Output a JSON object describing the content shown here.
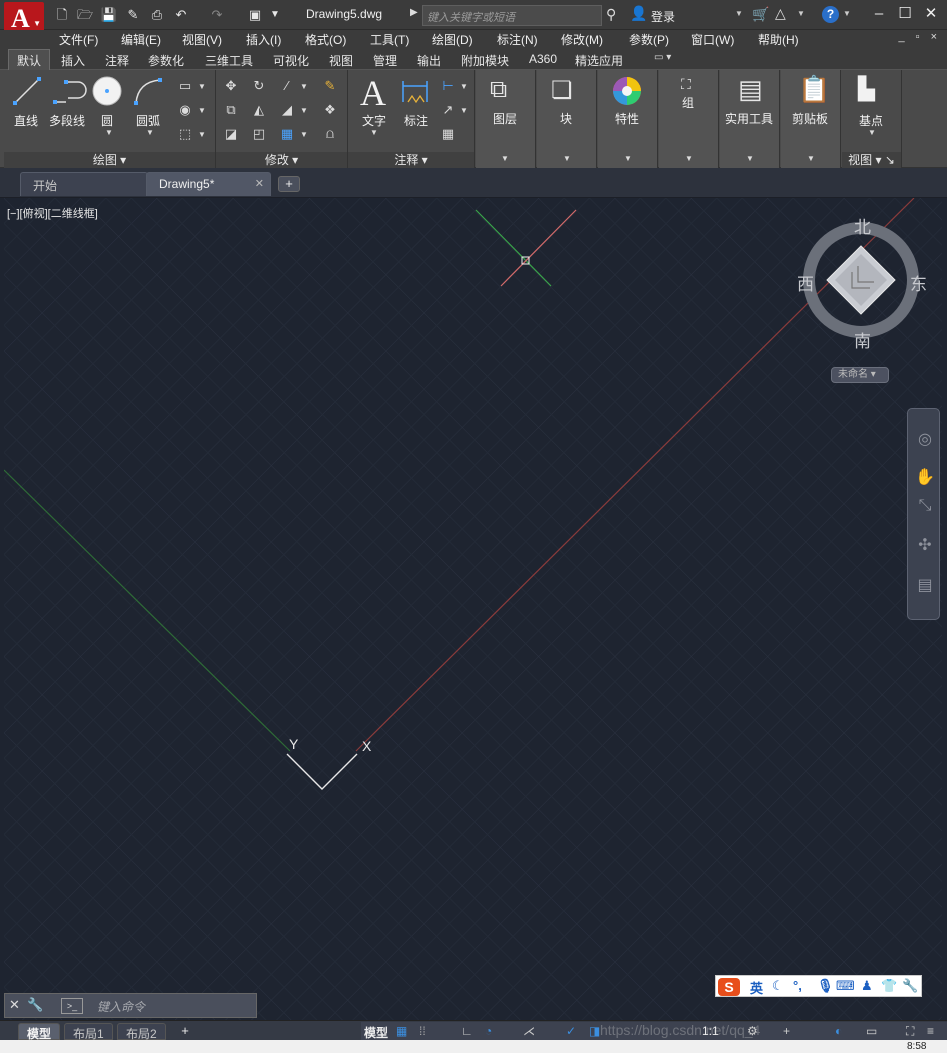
{
  "titlebar": {
    "app_letter": "A",
    "doc_title": "Drawing5.dwg",
    "search_placeholder": "键入关键字或短语",
    "login": "登录"
  },
  "menubar": {
    "items": [
      "文件(F)",
      "编辑(E)",
      "视图(V)",
      "插入(I)",
      "格式(O)",
      "工具(T)",
      "绘图(D)",
      "标注(N)",
      "修改(M)",
      "参数(P)",
      "窗口(W)",
      "帮助(H)"
    ],
    "window_controls": "_ ▫ ×"
  },
  "ribbon_tabs": [
    "默认",
    "插入",
    "注释",
    "参数化",
    "三维工具",
    "可视化",
    "视图",
    "管理",
    "输出",
    "附加模块",
    "A360",
    "精选应用"
  ],
  "ribbon": {
    "draw": {
      "title": "绘图",
      "line": "直线",
      "polyline": "多段线",
      "circle": "圆",
      "arc": "圆弧"
    },
    "modify": {
      "title": "修改"
    },
    "annotation": {
      "title": "注释",
      "text": "文字",
      "dimension": "标注"
    },
    "layers": "图层",
    "block": "块",
    "properties": "特性",
    "group": "组",
    "utilities": "实用工具",
    "clipboard": "剪贴板",
    "view": {
      "title": "视图",
      "basepoint": "基点"
    }
  },
  "file_tabs": {
    "start": "开始",
    "drawing": "Drawing5*"
  },
  "viewport": {
    "label": "[−][俯视][二维线框]",
    "ucs_y": "Y",
    "ucs_x": "X"
  },
  "viewcube": {
    "north": "北",
    "south": "南",
    "east": "东",
    "west": "西",
    "ucs_name": "未命名"
  },
  "ime": {
    "logo": "S",
    "lang": "英"
  },
  "cmdline": {
    "placeholder": "键入命令"
  },
  "statusbar": {
    "layouts": [
      "模型",
      "布局1",
      "布局2"
    ],
    "model": "模型",
    "scale": "1:1"
  },
  "taskbar": {
    "clock": "8:58"
  },
  "watermark": "https://blog.csdn.net/qq_4"
}
